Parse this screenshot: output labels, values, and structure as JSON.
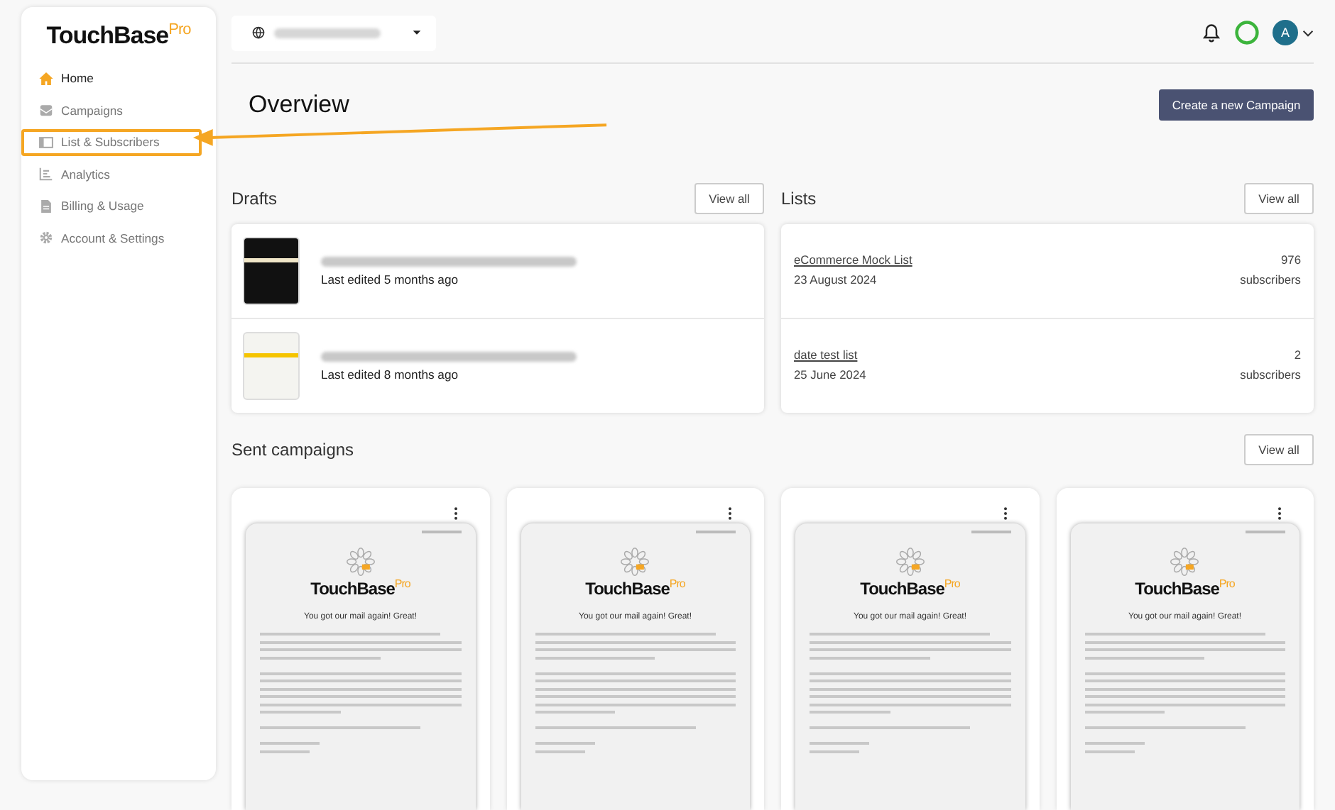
{
  "brand": {
    "name": "TouchBase",
    "suffix": "Pro"
  },
  "sidebar": {
    "items": [
      {
        "label": "Home",
        "kind": "home",
        "selected": true,
        "annotated": false
      },
      {
        "label": "Campaigns",
        "kind": "campaigns",
        "selected": false,
        "annotated": false
      },
      {
        "label": "List & Subscribers",
        "kind": "list",
        "selected": false,
        "annotated": true
      },
      {
        "label": "Analytics",
        "kind": "analytics",
        "selected": false,
        "annotated": false
      },
      {
        "label": "Billing & Usage",
        "kind": "billing",
        "selected": false,
        "annotated": false
      },
      {
        "label": "Account & Settings",
        "kind": "settings",
        "selected": false,
        "annotated": false
      }
    ]
  },
  "topbar": {
    "avatar": "A"
  },
  "page": {
    "title": "Overview",
    "primary_button": "Create a new Campaign"
  },
  "drafts": {
    "title": "Drafts",
    "view_all": "View all",
    "items": [
      {
        "edited": "Last edited 5 months ago",
        "kind": "dark"
      },
      {
        "edited": "Last edited 8 months ago",
        "kind": "light"
      }
    ]
  },
  "lists": {
    "title": "Lists",
    "view_all": "View all",
    "items": [
      {
        "name": "eCommerce Mock List",
        "date": "23 August 2024",
        "count": "976",
        "unit": "subscribers"
      },
      {
        "name": "date test list",
        "date": "25 June 2024",
        "count": "2",
        "unit": "subscribers"
      }
    ]
  },
  "sent": {
    "title": "Sent campaigns",
    "view_all": "View all",
    "items": [
      {
        "logo_name": "TouchBase",
        "logo_suffix": "Pro",
        "heading": "You got our mail again! Great!"
      },
      {
        "logo_name": "TouchBase",
        "logo_suffix": "Pro",
        "heading": "You got our mail again! Great!"
      },
      {
        "logo_name": "TouchBase",
        "logo_suffix": "Pro",
        "heading": "You got our mail again! Great!"
      },
      {
        "logo_name": "TouchBase",
        "logo_suffix": "Pro",
        "heading": "You got our mail again! Great!"
      }
    ]
  }
}
